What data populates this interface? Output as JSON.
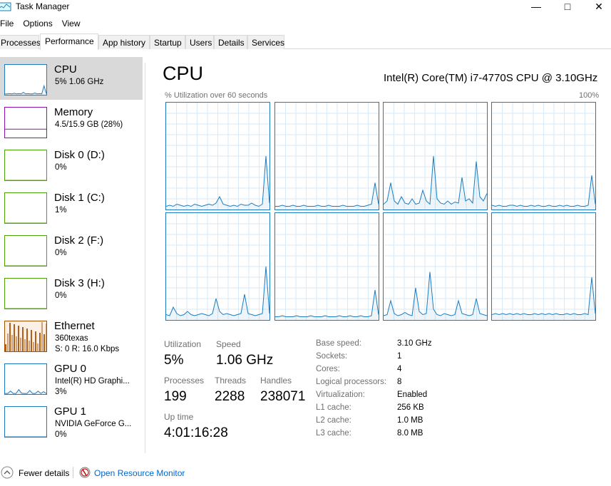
{
  "window": {
    "title": "Task Manager",
    "controls": [
      "minimize",
      "maximize",
      "close"
    ]
  },
  "menu": [
    "File",
    "Options",
    "View"
  ],
  "tabs": [
    "Processes",
    "Performance",
    "App history",
    "Startup",
    "Users",
    "Details",
    "Services"
  ],
  "active_tab": "Performance",
  "sidebar": [
    {
      "name": "CPU",
      "line1": "5% 1.06 GHz",
      "line2": "",
      "color": "#1b7cc1",
      "selected": true
    },
    {
      "name": "Memory",
      "line1": "4.5/15.9 GB (28%)",
      "line2": "",
      "color": "#8b12ae"
    },
    {
      "name": "Disk 0 (D:)",
      "line1": "0%",
      "line2": "",
      "color": "#4da60c"
    },
    {
      "name": "Disk 1 (C:)",
      "line1": "1%",
      "line2": "",
      "color": "#4da60c"
    },
    {
      "name": "Disk 2 (F:)",
      "line1": "0%",
      "line2": "",
      "color": "#4da60c"
    },
    {
      "name": "Disk 3 (H:)",
      "line1": "0%",
      "line2": "",
      "color": "#4da60c"
    },
    {
      "name": "Ethernet",
      "line1": "360texas",
      "line2": "S: 0 R: 16.0 Kbps",
      "color": "#a74f01"
    },
    {
      "name": "GPU 0",
      "line1": "Intel(R) HD Graphi...",
      "line2": "3%",
      "color": "#1b7cc1"
    },
    {
      "name": "GPU 1",
      "line1": "NVIDIA GeForce G...",
      "line2": "0%",
      "color": "#1b7cc1"
    }
  ],
  "main": {
    "title": "CPU",
    "model": "Intel(R) Core(TM) i7-4770S CPU @ 3.10GHz",
    "graph_label": "% Utilization over 60 seconds",
    "graph_max": "100%",
    "cores": [
      [
        3,
        4,
        3,
        5,
        4,
        3,
        4,
        3,
        5,
        4,
        3,
        4,
        5,
        4,
        6,
        12,
        5,
        4,
        3,
        4,
        3,
        5,
        4,
        4,
        6,
        4,
        3,
        5,
        50,
        6
      ],
      [
        3,
        3,
        4,
        3,
        3,
        4,
        3,
        3,
        4,
        3,
        3,
        3,
        4,
        3,
        3,
        4,
        3,
        3,
        3,
        4,
        3,
        3,
        3,
        4,
        3,
        3,
        4,
        5,
        25,
        5
      ],
      [
        5,
        8,
        25,
        8,
        5,
        12,
        6,
        5,
        10,
        5,
        6,
        18,
        8,
        5,
        50,
        10,
        6,
        5,
        8,
        5,
        7,
        6,
        30,
        8,
        10,
        6,
        45,
        12,
        8,
        15
      ],
      [
        4,
        3,
        4,
        3,
        3,
        4,
        4,
        3,
        4,
        3,
        3,
        4,
        3,
        4,
        3,
        3,
        4,
        3,
        3,
        4,
        3,
        4,
        3,
        3,
        4,
        3,
        3,
        4,
        32,
        5
      ],
      [
        5,
        4,
        12,
        6,
        4,
        5,
        8,
        5,
        4,
        5,
        6,
        5,
        4,
        6,
        20,
        8,
        5,
        6,
        5,
        4,
        5,
        6,
        24,
        6,
        5,
        4,
        5,
        6,
        50,
        6
      ],
      [
        3,
        3,
        4,
        3,
        3,
        3,
        4,
        3,
        3,
        3,
        4,
        3,
        3,
        3,
        4,
        3,
        3,
        3,
        4,
        3,
        3,
        4,
        3,
        3,
        4,
        3,
        3,
        4,
        28,
        5
      ],
      [
        4,
        5,
        18,
        6,
        4,
        5,
        7,
        5,
        4,
        30,
        8,
        5,
        6,
        45,
        10,
        5,
        4,
        6,
        5,
        4,
        5,
        18,
        6,
        5,
        4,
        5,
        20,
        6,
        5,
        4
      ],
      [
        5,
        6,
        5,
        6,
        5,
        6,
        5,
        6,
        5,
        6,
        5,
        5,
        6,
        5,
        6,
        5,
        6,
        5,
        6,
        5,
        5,
        6,
        5,
        6,
        5,
        5,
        6,
        5,
        40,
        6
      ]
    ],
    "stats": {
      "utilization_label": "Utilization",
      "utilization": "5%",
      "speed_label": "Speed",
      "speed": "1.06 GHz",
      "processes_label": "Processes",
      "processes": "199",
      "threads_label": "Threads",
      "threads": "2288",
      "handles_label": "Handles",
      "handles": "238071",
      "uptime_label": "Up time",
      "uptime": "4:01:16:28"
    },
    "specs": [
      {
        "k": "Base speed:",
        "v": "3.10 GHz"
      },
      {
        "k": "Sockets:",
        "v": "1"
      },
      {
        "k": "Cores:",
        "v": "4"
      },
      {
        "k": "Logical processors:",
        "v": "8"
      },
      {
        "k": "Virtualization:",
        "v": "Enabled"
      },
      {
        "k": "L1 cache:",
        "v": "256 KB"
      },
      {
        "k": "L2 cache:",
        "v": "1.0 MB"
      },
      {
        "k": "L3 cache:",
        "v": "8.0 MB"
      }
    ]
  },
  "footer": {
    "fewer": "Fewer details",
    "monitor": "Open Resource Monitor"
  }
}
